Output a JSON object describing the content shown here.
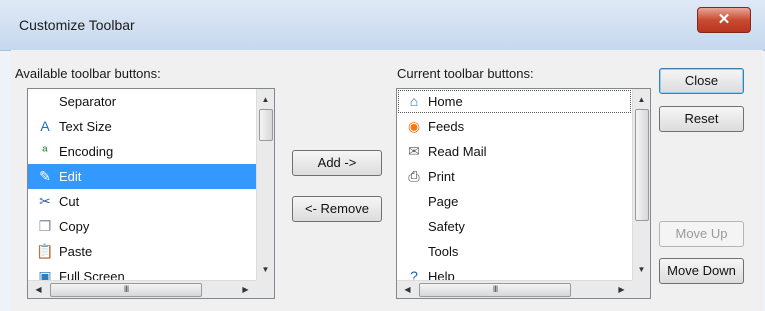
{
  "window": {
    "title": "Customize Toolbar",
    "close_glyph": "✕"
  },
  "available": {
    "label": "Available toolbar buttons:",
    "items": [
      {
        "label": "Separator",
        "icon": ""
      },
      {
        "label": "Text Size",
        "icon": "A",
        "color": "#1f6fbf"
      },
      {
        "label": "Encoding",
        "icon": "ª",
        "color": "#2a8a3a"
      },
      {
        "label": "Edit",
        "icon": "✎",
        "color": "#6a7d1a"
      },
      {
        "label": "Cut",
        "icon": "✂",
        "color": "#2b5fa8"
      },
      {
        "label": "Copy",
        "icon": "❐",
        "color": "#7a8aa0"
      },
      {
        "label": "Paste",
        "icon": "📋",
        "color": "#8a6a3a"
      },
      {
        "label": "Full Screen",
        "icon": "▣",
        "color": "#2b7fbf"
      }
    ],
    "selected_index": 3,
    "scroll_h_thumb": "III"
  },
  "buttons": {
    "add": "Add ->",
    "remove": "<- Remove"
  },
  "current": {
    "label": "Current toolbar buttons:",
    "items": [
      {
        "label": "Home",
        "icon": "⌂",
        "color": "#2f6fc0"
      },
      {
        "label": "Feeds",
        "icon": "◉",
        "color": "#f07a1a"
      },
      {
        "label": "Read Mail",
        "icon": "✉",
        "color": "#6a6a6a"
      },
      {
        "label": "Print",
        "icon": "⎙",
        "color": "#444444"
      },
      {
        "label": "Page",
        "icon": ""
      },
      {
        "label": "Safety",
        "icon": ""
      },
      {
        "label": "Tools",
        "icon": ""
      },
      {
        "label": "Help",
        "icon": "?",
        "color": "#1f5fb8"
      }
    ],
    "focused_index": 0,
    "scroll_h_thumb": "III"
  },
  "side_buttons": {
    "close": "Close",
    "reset": "Reset",
    "move_up": "Move Up",
    "move_down": "Move Down"
  }
}
